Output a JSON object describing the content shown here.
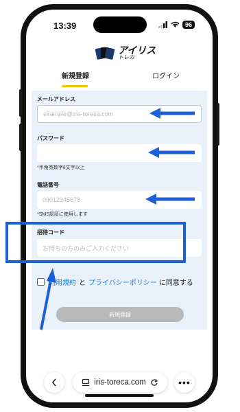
{
  "status_bar": {
    "time": "13:39",
    "battery": "96"
  },
  "logo": {
    "text": "アイリス",
    "subtext": "トレカ"
  },
  "tabs": [
    {
      "label": "新規登録",
      "active": true
    },
    {
      "label": "ログイン",
      "active": false
    }
  ],
  "form": {
    "email": {
      "label": "メールアドレス",
      "placeholder": "example@iris-toreca.com"
    },
    "password": {
      "label": "パスワード",
      "placeholder": "",
      "hint": "*半角英数字8文字以上"
    },
    "phone": {
      "label": "電話番号",
      "placeholder": "09012345678",
      "hint": "*SMS認証に使用します"
    },
    "invite": {
      "label": "招待コード",
      "placeholder": "お持ちの方のみご入力ください"
    },
    "agreement": {
      "terms_link": "利用規約",
      "and": "と",
      "privacy_link": "プライバシーポリシー",
      "suffix": "に同意する"
    },
    "submit_label": "新規登録"
  },
  "browser": {
    "url": "iris-toreca.com"
  },
  "colors": {
    "accent_tab": "#f5c400",
    "annotation": "#1c5fd6",
    "link": "#1c7ed6",
    "form_bg": "#e9f1fb"
  }
}
